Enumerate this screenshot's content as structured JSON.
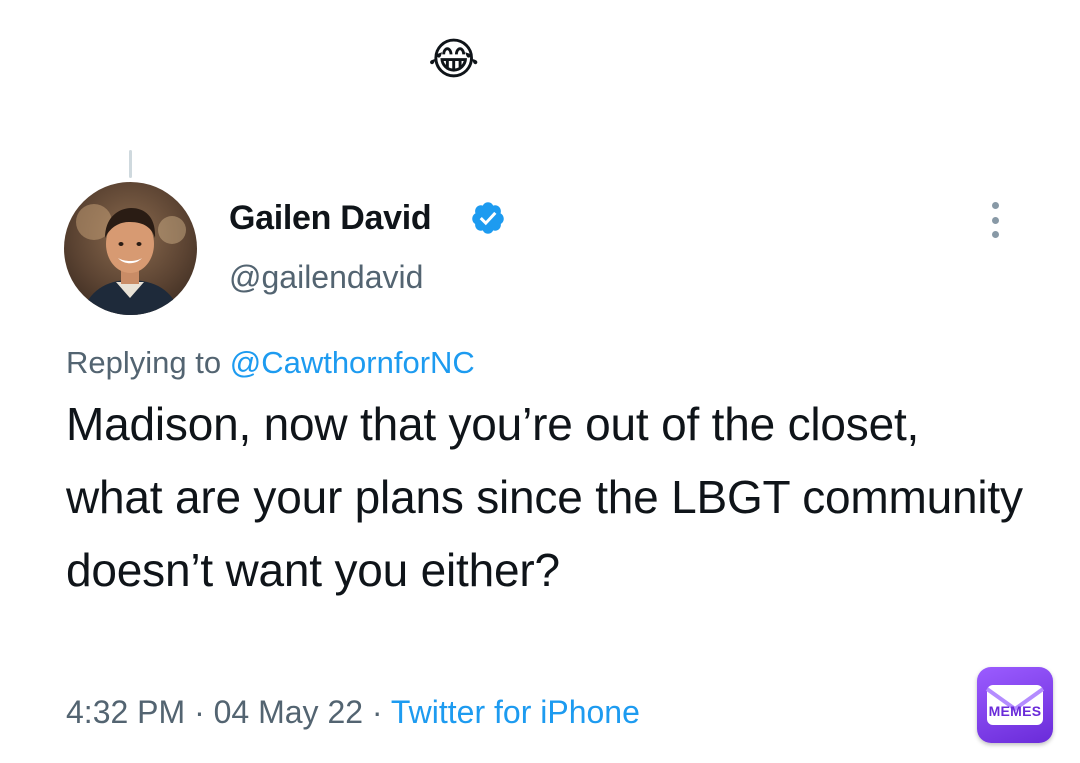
{
  "header": {
    "emoji": "😂"
  },
  "tweet": {
    "author_name": "Gailen David",
    "handle": "@gailendavid",
    "verified": true,
    "replying_prefix": "Replying to",
    "replying_to": "@CawthornforNC",
    "text": "Madison, now that you’re out of the closet, what are your plans since the LBGT community doesn’t want you either?",
    "time": "4:32 PM",
    "separator": "·",
    "date": "04 May 22",
    "source": "Twitter for iPhone"
  },
  "icons": {
    "verified": "verified-badge-icon",
    "more": "more-options-icon",
    "watermark": "memes-envelope-icon"
  },
  "watermark": {
    "label": "MEMES"
  },
  "colors": {
    "link": "#1d9bf0",
    "secondary_text": "#536471",
    "primary_text": "#0f1419",
    "badge_gradient_start": "#9b5cff",
    "badge_gradient_end": "#6a2bd9"
  }
}
